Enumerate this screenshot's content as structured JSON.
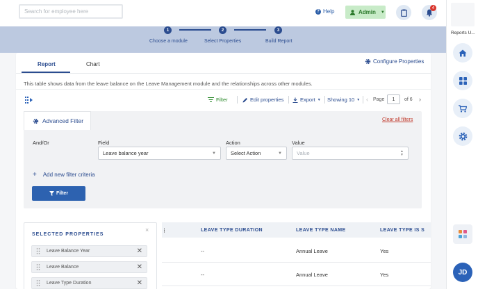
{
  "header": {
    "search_placeholder": "Search for employee here",
    "help_label": "Help",
    "admin_label": "Admin",
    "notification_count": "4"
  },
  "steps": [
    {
      "number": "1",
      "label": "Choose a module"
    },
    {
      "number": "2",
      "label": "Select Properties"
    },
    {
      "number": "3",
      "label": "Build Report"
    }
  ],
  "tabs": [
    {
      "label": "Report",
      "active": true
    },
    {
      "label": "Chart",
      "active": false
    }
  ],
  "configure_label": "Configure Properties",
  "description": "This table shows data from the leave balance on the Leave Management module and the relationships across other modules.",
  "toolbar": {
    "filter_label": "Filter",
    "edit_label": "Edit properties",
    "export_label": "Export",
    "showing_label": "Showing 10",
    "page_label": "Page",
    "page_value": "1",
    "of_label": "of 6"
  },
  "advanced_filter": {
    "title": "Advanced Filter",
    "clear_label": "Clear all filters",
    "and_or_label": "And/Or",
    "field_label": "Field",
    "action_label": "Action",
    "value_label": "Value",
    "field_value": "Leave balance year",
    "action_value": "Select Action",
    "value_placeholder": "Value",
    "add_criteria_label": "Add new filter criteria",
    "filter_button_label": "Filter"
  },
  "selected_properties": {
    "title": "SELECTED PROPERTIES",
    "items": [
      "Leave Balance Year",
      "Leave Balance",
      "Leave Type Duration"
    ]
  },
  "table": {
    "columns": [
      "LEAVE TYPE DURATION",
      "LEAVE TYPE NAME",
      "LEAVE TYPE IS S"
    ],
    "rows": [
      [
        "--",
        "Annual Leave",
        "Yes"
      ],
      [
        "--",
        "Annual Leave",
        "Yes"
      ]
    ]
  },
  "rail": {
    "label": "Reports U...",
    "avatar_initials": "JD"
  },
  "colors": {
    "primary": "#2b4c8f",
    "filter_green": "#2b8a2b",
    "danger": "#c0392b",
    "hero": "#bcc9e0"
  }
}
